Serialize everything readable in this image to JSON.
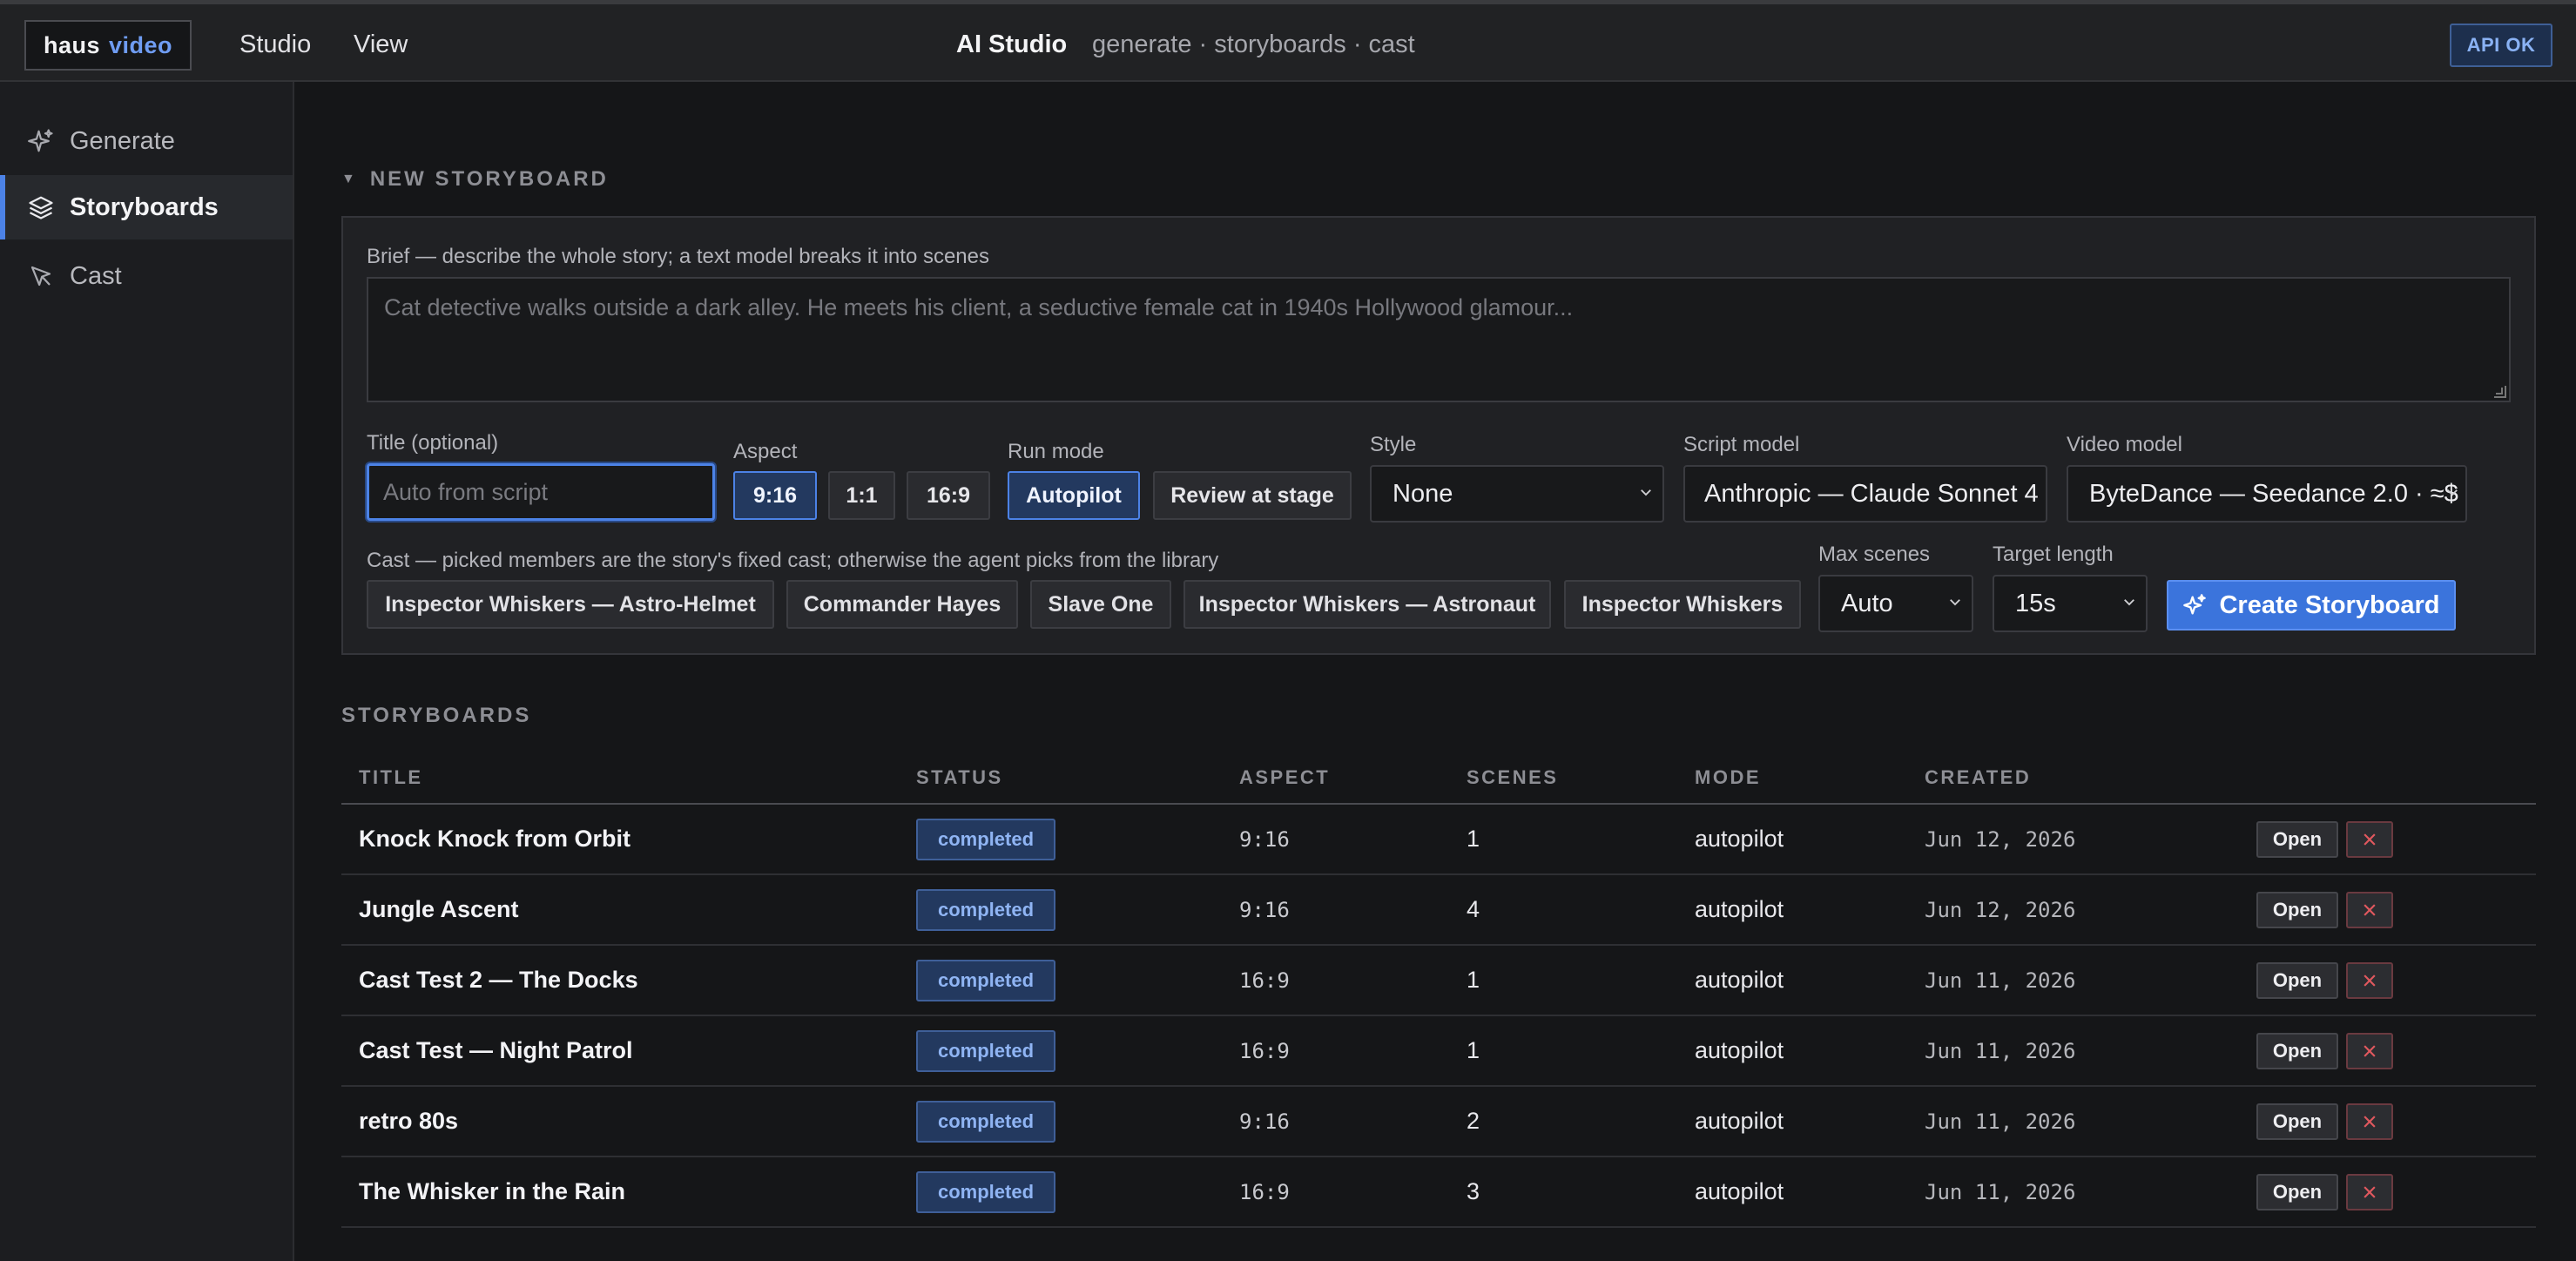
{
  "brand": {
    "part1": "haus",
    "part2": "video"
  },
  "menu": {
    "studio": "Studio",
    "view": "View"
  },
  "header": {
    "title": "AI Studio",
    "subtitle": "generate · storyboards · cast",
    "api_status": "API OK"
  },
  "sidebar": {
    "items": [
      {
        "label": "Generate",
        "icon": "sparkle-icon",
        "active": false
      },
      {
        "label": "Storyboards",
        "icon": "layers-icon",
        "active": true
      },
      {
        "label": "Cast",
        "icon": "cursor-icon",
        "active": false
      }
    ]
  },
  "new_storyboard": {
    "section_title": "NEW STORYBOARD",
    "brief_label": "Brief — describe the whole story; a text model breaks it into scenes",
    "brief_placeholder": "Cat detective walks outside a dark alley. He meets his client, a seductive female cat in 1940s Hollywood glamour...",
    "title_label": "Title (optional)",
    "title_placeholder": "Auto from script",
    "aspect_label": "Aspect",
    "aspect_options": [
      "9:16",
      "1:1",
      "16:9"
    ],
    "aspect_selected": "9:16",
    "run_mode_label": "Run mode",
    "run_mode_options": [
      "Autopilot",
      "Review at stage"
    ],
    "run_mode_selected": "Autopilot",
    "style_label": "Style",
    "style_value": "None",
    "script_model_label": "Script model",
    "script_model_value": "Anthropic — Claude Sonnet 4",
    "video_model_label": "Video model",
    "video_model_value": "ByteDance — Seedance 2.0 · ≈$",
    "cast_label": "Cast — picked members are the story's fixed cast; otherwise the agent picks from the library",
    "cast_members": [
      "Inspector Whiskers — Astro-Helmet",
      "Commander Hayes",
      "Slave One",
      "Inspector Whiskers — Astronaut",
      "Inspector Whiskers"
    ],
    "max_scenes_label": "Max scenes",
    "max_scenes_value": "Auto",
    "target_length_label": "Target length",
    "target_length_value": "15s",
    "create_label": "Create Storyboard"
  },
  "storyboards": {
    "section_title": "STORYBOARDS",
    "columns": [
      "TITLE",
      "STATUS",
      "ASPECT",
      "SCENES",
      "MODE",
      "CREATED"
    ],
    "open_label": "Open",
    "rows": [
      {
        "title": "Knock Knock from Orbit",
        "status": "completed",
        "aspect": "9:16",
        "scenes": "1",
        "mode": "autopilot",
        "created": "Jun 12, 2026"
      },
      {
        "title": "Jungle Ascent",
        "status": "completed",
        "aspect": "9:16",
        "scenes": "4",
        "mode": "autopilot",
        "created": "Jun 12, 2026"
      },
      {
        "title": "Cast Test 2 — The Docks",
        "status": "completed",
        "aspect": "16:9",
        "scenes": "1",
        "mode": "autopilot",
        "created": "Jun 11, 2026"
      },
      {
        "title": "Cast Test — Night Patrol",
        "status": "completed",
        "aspect": "16:9",
        "scenes": "1",
        "mode": "autopilot",
        "created": "Jun 11, 2026"
      },
      {
        "title": "retro 80s",
        "status": "completed",
        "aspect": "9:16",
        "scenes": "2",
        "mode": "autopilot",
        "created": "Jun 11, 2026"
      },
      {
        "title": "The Whisker in the Rain",
        "status": "completed",
        "aspect": "16:9",
        "scenes": "3",
        "mode": "autopilot",
        "created": "Jun 11, 2026"
      }
    ]
  },
  "colors": {
    "accent": "#4c82e6",
    "background": "#151618",
    "danger": "#d9534f"
  }
}
